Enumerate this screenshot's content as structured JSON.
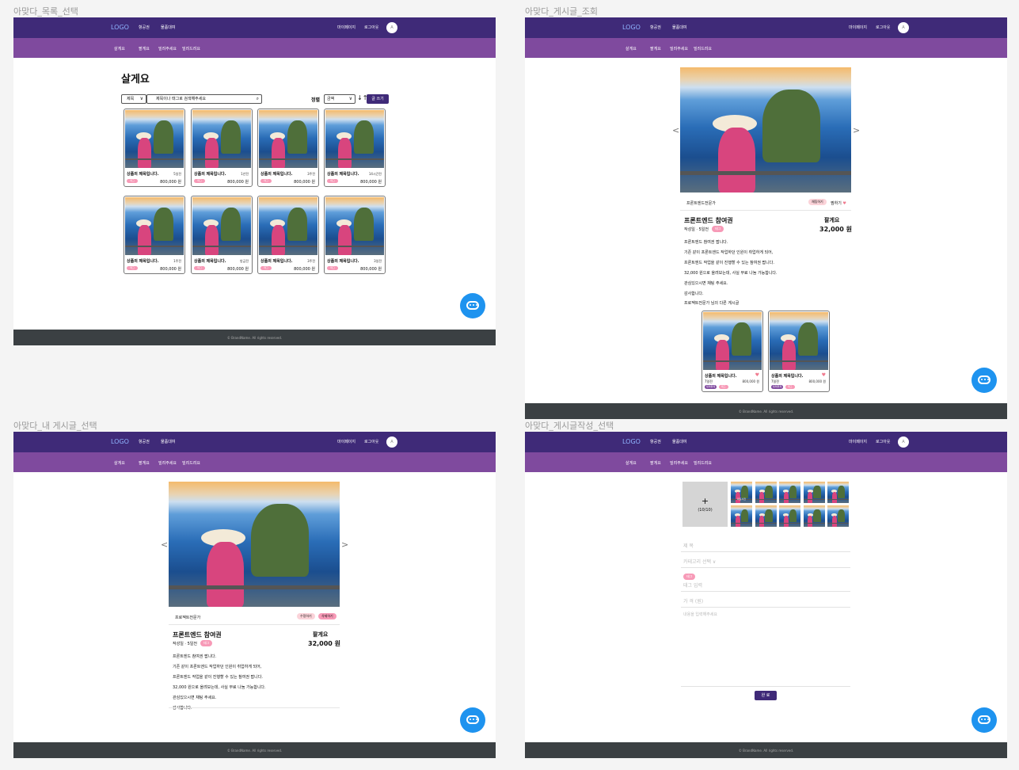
{
  "frames": {
    "list": "아맞다_목록_선택",
    "view": "아맞다_게시글_조회",
    "mine": "아맞다_내 게시글_선택",
    "write": "아맞다_게시글작성_선택"
  },
  "header": {
    "logo": "LOGO",
    "nav1": "항공권",
    "nav2": "물품대여",
    "mypage": "마이페이지",
    "logout": "로그아웃",
    "avatar": "A"
  },
  "subnav": [
    "살게요",
    "팔게요",
    "빌려주세요",
    "빌려드려요"
  ],
  "footer": "© BrandName. All rights reserved.",
  "list": {
    "title": "살게요",
    "search_select": "제목",
    "search_placeholder": "제목이나 태그로 검색해주세요",
    "sort_label": "정렬",
    "sort_select": "금액",
    "sort_icon": "↓↑",
    "write_button": "글 쓰기",
    "cards": [
      {
        "title": "상품의 제목입니다.",
        "date": "5일전",
        "tag": "태그",
        "price": "800,000 원"
      },
      {
        "title": "상품의 제목입니다.",
        "date": "1년전",
        "tag": "태그",
        "price": "800,000 원"
      },
      {
        "title": "상품의 제목입니다.",
        "date": "3주전",
        "tag": "태그",
        "price": "800,000 원"
      },
      {
        "title": "상품의 제목입니다.",
        "date": "14시간전",
        "tag": "태그",
        "price": "800,000 원"
      },
      {
        "title": "상품의 제목입니다.",
        "date": "1주전",
        "tag": "태그",
        "price": "800,000 원"
      },
      {
        "title": "상품의 제목입니다.",
        "date": "방금전",
        "tag": "태그",
        "price": "800,000 원"
      },
      {
        "title": "상품의 제목입니다.",
        "date": "3주전",
        "tag": "태그",
        "price": "800,000 원"
      },
      {
        "title": "상품의 제목입니다.",
        "date": "3일전",
        "tag": "태그",
        "price": "800,000 원"
      }
    ]
  },
  "post": {
    "author": "프론트엔드전문가",
    "chat_button": "채팅하기",
    "like_button": "찜하기",
    "title": "프론트엔드 참여권",
    "category": "팔게요",
    "meta": "작성일 · 5일전",
    "tag": "태그",
    "price": "32,000 원",
    "body": [
      "프론트엔드 참여권 팝니다.",
      "기존 같이 프론트엔드 작업하던 인원이 취업하게 되어,",
      "프론트엔드 작업을 같이 진행할 수 있는 참여권 팝니다.",
      "32,000 원으로 올려보는데, 사실 무료 나눔 가능합니다.",
      "관심있으시면 채팅 주세요.",
      "감사합니다."
    ],
    "other_heading": "프로젝트전문가 님의 다른 게시글",
    "other_cards": [
      {
        "title": "상품의 제목입니다.",
        "date": "7일전",
        "tags": [
          "빌려줄게",
          "태그"
        ],
        "price": "800,000 원"
      },
      {
        "title": "상품의 제목입니다.",
        "date": "7일전",
        "tags": [
          "빌려줄게",
          "태그"
        ],
        "price": "800,000 원"
      }
    ]
  },
  "mine": {
    "author": "프로젝트전문가",
    "edit_button": "수정하기",
    "delete_button": "삭제하기"
  },
  "write": {
    "upload_plus": "+",
    "upload_count": "(10/10)",
    "thumb_label": "대표사진",
    "title_ph": "제 목",
    "category_ph": "카테고리 선택 ∨",
    "tag": "태그",
    "tag_ph": "태그 입력",
    "price_ph": "가 격 (원)",
    "content_ph": "내용을 입력해주세요",
    "submit": "완 료"
  },
  "colors": {
    "header": "#3f2a78",
    "subnav": "#7f4a9e",
    "footer": "#3b4043",
    "chat": "#1e93ef",
    "tag": "#f79ab7"
  }
}
